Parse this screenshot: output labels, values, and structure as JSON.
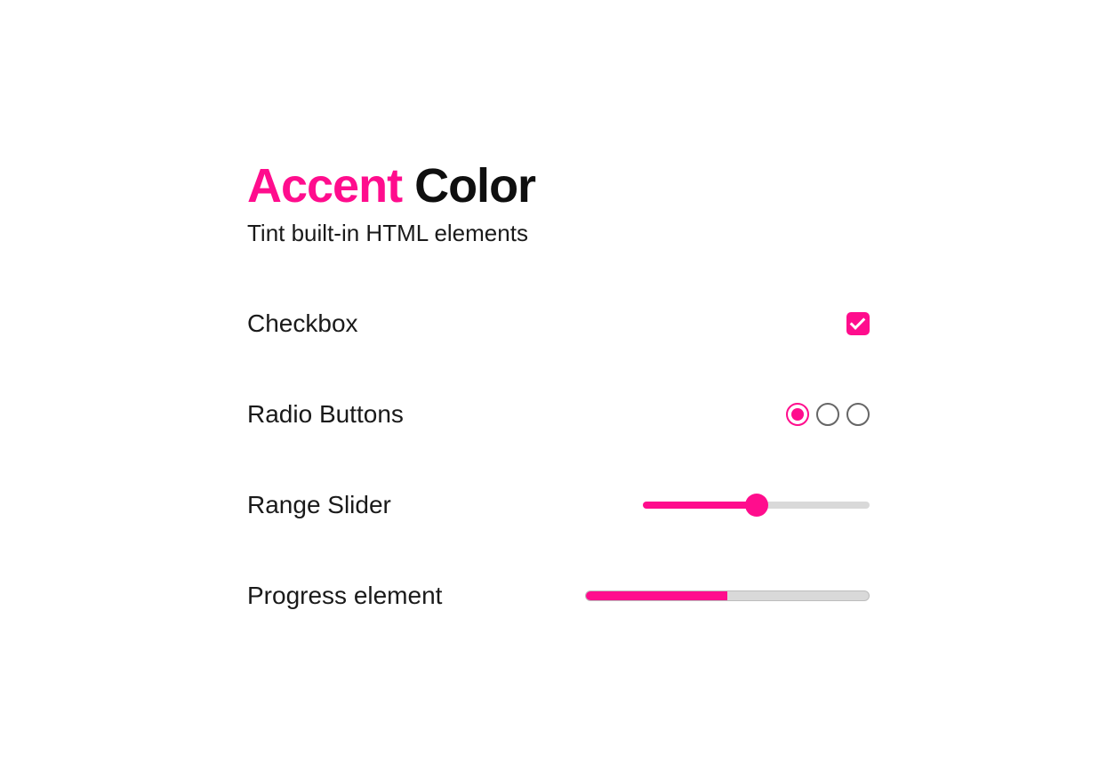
{
  "accent_color": "#ff0d8d",
  "title": {
    "word1": "Accent",
    "word2": "Color"
  },
  "subtitle": "Tint built-in HTML elements",
  "rows": {
    "checkbox": {
      "label": "Checkbox",
      "checked": true
    },
    "radio": {
      "label": "Radio Buttons",
      "options": [
        {
          "checked": true
        },
        {
          "checked": false
        },
        {
          "checked": false
        }
      ]
    },
    "range": {
      "label": "Range Slider",
      "min": 0,
      "max": 100,
      "value": 50
    },
    "progress": {
      "label": "Progress element",
      "max": 100,
      "value": 50
    }
  }
}
